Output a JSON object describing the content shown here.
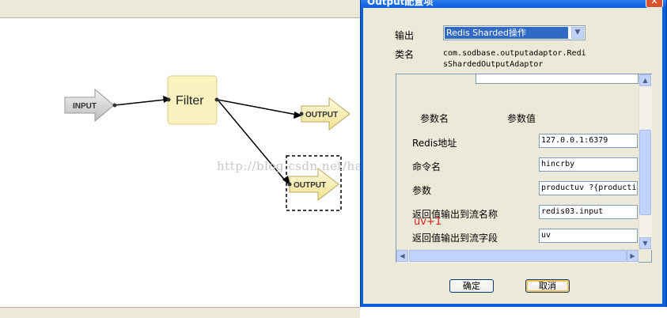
{
  "flow": {
    "nodes": {
      "input": "INPUT",
      "filter": "Filter",
      "output1": "OUTPUT",
      "output2": "OUTPUT"
    },
    "watermark": "http://blog.csdn.net/happyhear"
  },
  "dialog": {
    "title": "Output配置项",
    "close": "✕",
    "output_label": "输出",
    "output_value": "Redis Sharded操作",
    "class_label": "类名",
    "class_value_line1": "com.sodbase.outputadaptor.Redi",
    "class_value_line2": "sShardedOutputAdaptor",
    "param_header_name": "参数名",
    "param_header_value": "参数值",
    "params": [
      {
        "name": "Redis地址",
        "value": "127.0.0.1:6379"
      },
      {
        "name": "命令名",
        "value": "hincrby"
      },
      {
        "name": "参数",
        "value": "productuv ?{producti"
      },
      {
        "name": "返回值输出到流名称",
        "value": "redis03.input"
      },
      {
        "name": "返回值输出到流字段",
        "value": "uv"
      }
    ],
    "annotation": "uv+1",
    "ok": "确定",
    "cancel": "取消"
  },
  "colors": {
    "titlebar": "#0a5fde",
    "selection": "#316ac5",
    "annotation": "#e02020",
    "filter_fill": "#fbf2c0"
  },
  "icons": {
    "combo_arrow": "chevron-down-icon",
    "close": "close-icon",
    "scroll_up": "arrow-up-icon",
    "scroll_down": "arrow-down-icon",
    "scroll_left": "arrow-left-icon",
    "scroll_right": "arrow-right-icon"
  }
}
